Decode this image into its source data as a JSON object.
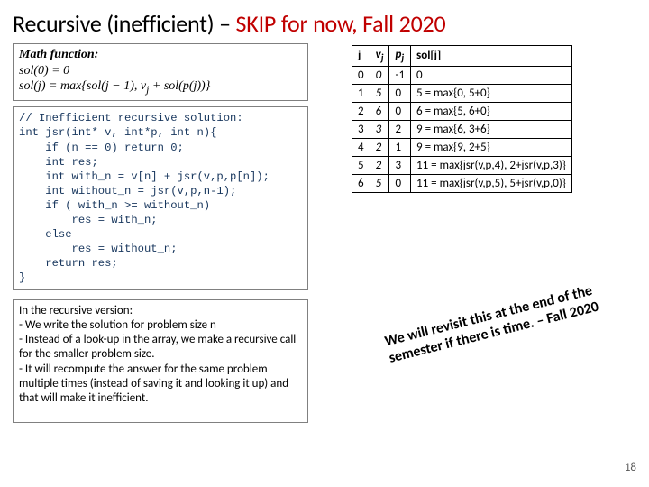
{
  "title": {
    "left": "Recursive (inefficient) – ",
    "right": "SKIP for now, Fall 2020"
  },
  "math": {
    "label": "Math function:",
    "line1_html": "sol(0) = 0",
    "line2_prefix": "sol(j) = max{sol(j − 1), v",
    "line2_sub": "j",
    "line2_mid": " + sol(p(j))}"
  },
  "code": "// Inefficient recursive solution:\nint jsr(int* v, int*p, int n){\n    if (n == 0) return 0;\n    int res;\n    int with_n = v[n] + jsr(v,p,p[n]);\n    int without_n = jsr(v,p,n-1);\n    if ( with_n >= without_n)\n        res = with_n;\n    else\n        res = without_n;\n    return res;\n}",
  "explain": "In the recursive version:\n - We write the solution for problem size n\n - Instead of a look-up in the array, we make a recursive call for the smaller problem size.\n - It will recompute the answer for the  same problem  multiple times (instead of saving it and looking it up) and that will make it inefficient.",
  "table": {
    "headers": [
      "j",
      "vj",
      "pj",
      "sol[j]"
    ],
    "rows": [
      {
        "j": "0",
        "v": "0",
        "p": "-1",
        "sol": "0"
      },
      {
        "j": "1",
        "v": "5",
        "p": "0",
        "sol": "5  = max{0, 5+0}"
      },
      {
        "j": "2",
        "v": "6",
        "p": "0",
        "sol": "6 = max{5, 6+0}"
      },
      {
        "j": "3",
        "v": "3",
        "p": "2",
        "sol": "9 = max{6, 3+6}"
      },
      {
        "j": "4",
        "v": "2",
        "p": "1",
        "sol": "9 = max{9, 2+5}"
      },
      {
        "j": "5",
        "v": "2",
        "p": "3",
        "sol": "11 = max{jsr(v,p,4), 2+jsr(v,p,3)}"
      },
      {
        "j": "6",
        "v": "5",
        "p": "0",
        "sol": "11 = max{jsr(v,p,5), 5+jsr(v,p,0)}"
      }
    ]
  },
  "stamp": "We will revisit this at the end of the semester if there is time. – Fall 2020",
  "page_number": "18"
}
